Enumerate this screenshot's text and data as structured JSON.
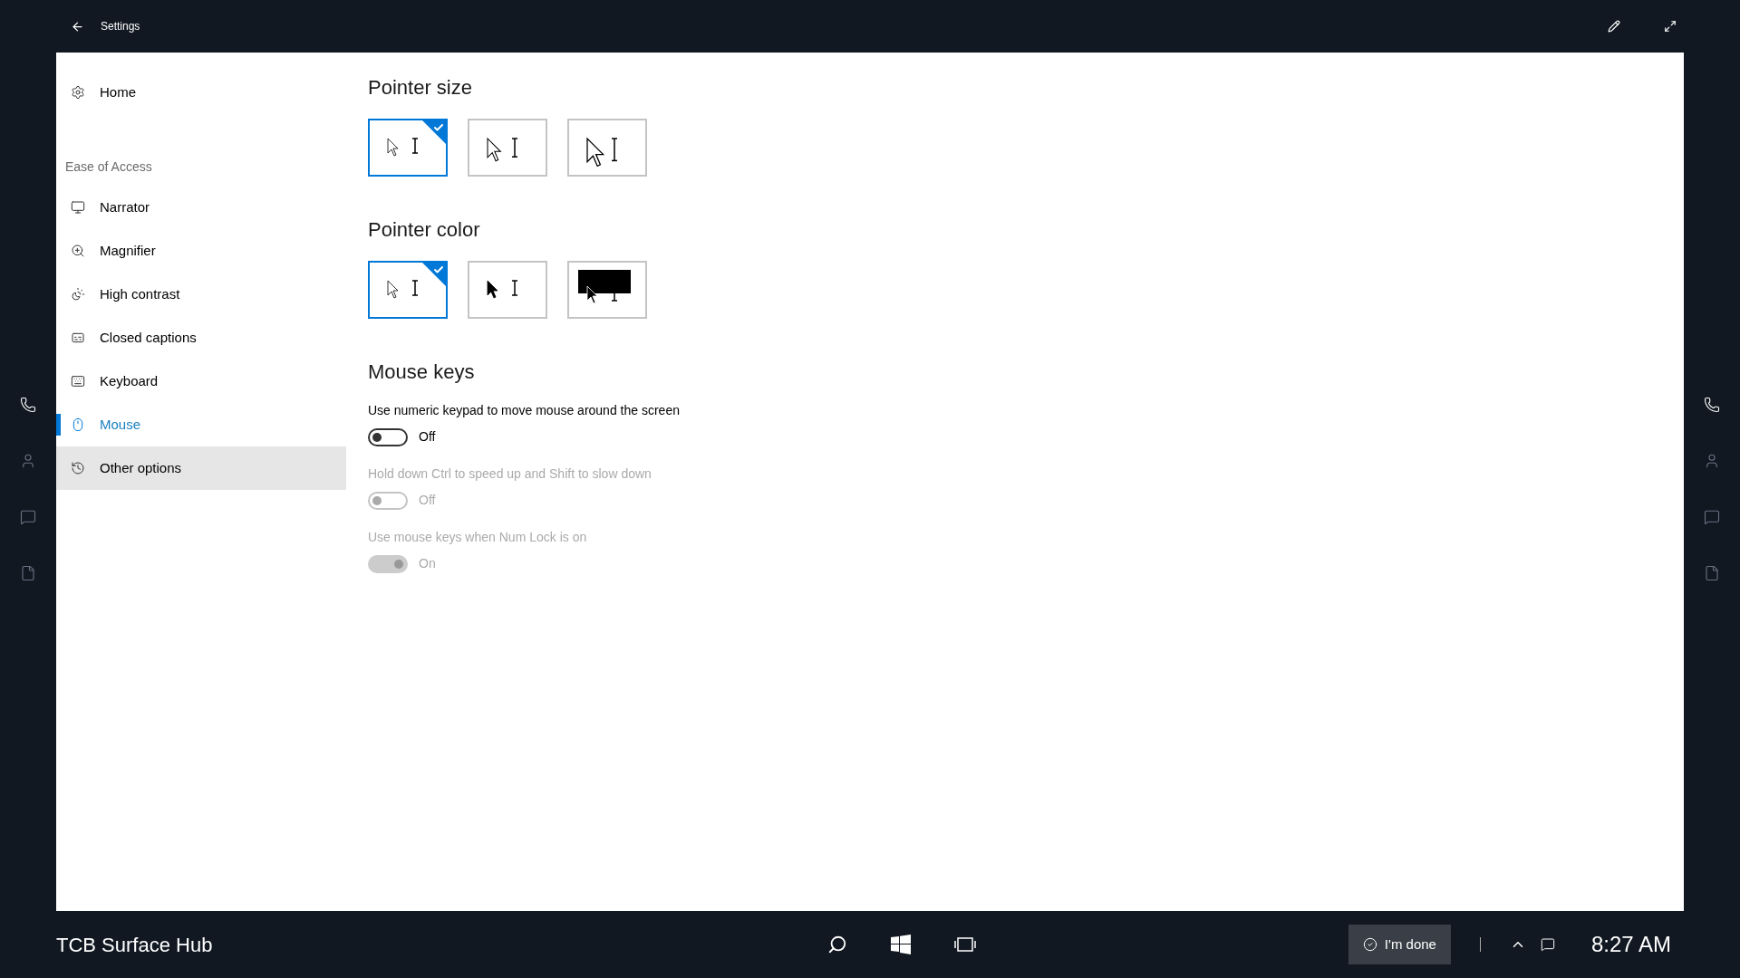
{
  "window": {
    "title": "Settings"
  },
  "sidebar": {
    "home": "Home",
    "section": "Ease of Access",
    "items": [
      {
        "label": "Narrator",
        "selected": false,
        "hovered": false
      },
      {
        "label": "Magnifier",
        "selected": false,
        "hovered": false
      },
      {
        "label": "High contrast",
        "selected": false,
        "hovered": false
      },
      {
        "label": "Closed captions",
        "selected": false,
        "hovered": false
      },
      {
        "label": "Keyboard",
        "selected": false,
        "hovered": false
      },
      {
        "label": "Mouse",
        "selected": true,
        "hovered": false
      },
      {
        "label": "Other options",
        "selected": false,
        "hovered": true
      }
    ]
  },
  "pointer_size": {
    "heading": "Pointer size",
    "options": [
      {
        "kind": "small",
        "selected": true
      },
      {
        "kind": "medium",
        "selected": false
      },
      {
        "kind": "large",
        "selected": false
      }
    ]
  },
  "pointer_color": {
    "heading": "Pointer color",
    "options": [
      {
        "kind": "white",
        "selected": true
      },
      {
        "kind": "black",
        "selected": false
      },
      {
        "kind": "inverted",
        "selected": false
      }
    ]
  },
  "mouse_keys": {
    "heading": "Mouse keys",
    "settings": [
      {
        "label": "Use numeric keypad to move mouse around the screen",
        "state": "Off",
        "on": false,
        "disabled": false
      },
      {
        "label": "Hold down Ctrl to speed up and Shift to slow down",
        "state": "Off",
        "on": false,
        "disabled": true
      },
      {
        "label": "Use mouse keys when Num Lock is on",
        "state": "On",
        "on": true,
        "disabled": true
      }
    ]
  },
  "taskbar": {
    "name": "TCB Surface Hub",
    "done_button": "I'm done",
    "time": "8:27 AM"
  }
}
